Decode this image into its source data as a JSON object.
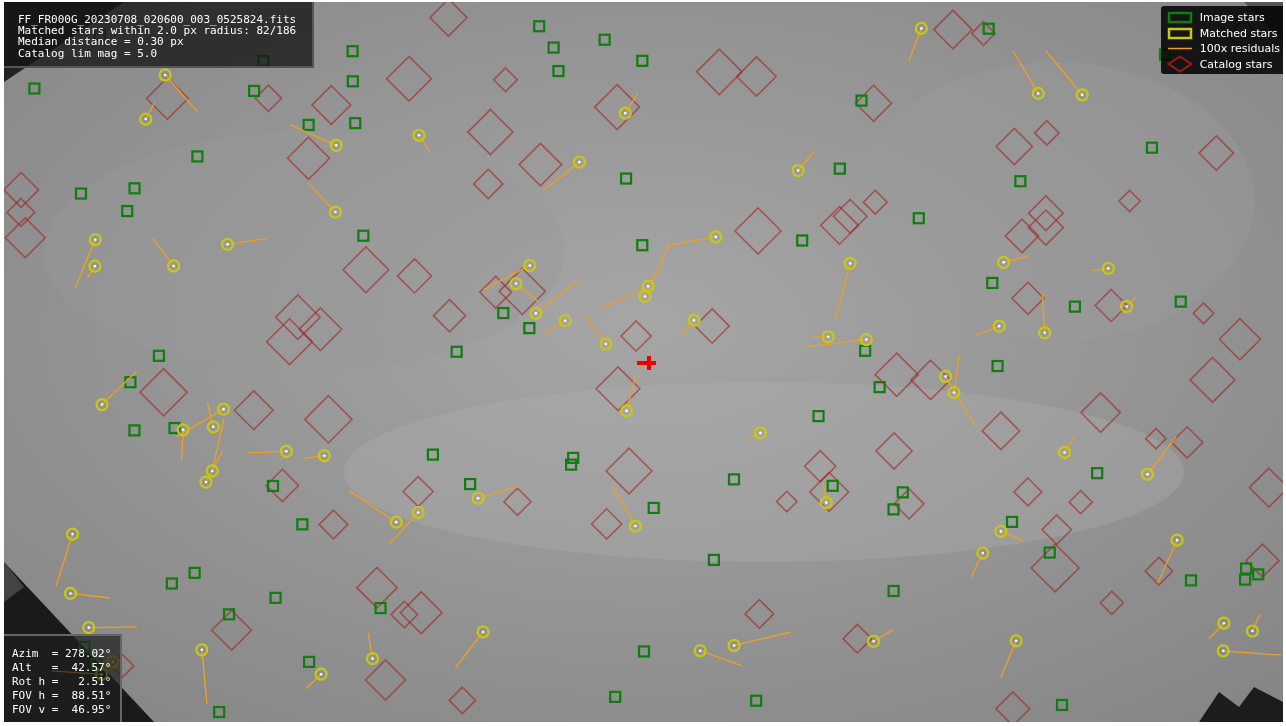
{
  "info_panel": {
    "lines": [
      "FF_FR000G_20230708_020600_003_0525824.fits",
      "Matched stars within 2.0 px radius: 82/186",
      "Median distance = 0.30 px",
      "Catalog lim mag = 5.0"
    ]
  },
  "legend": {
    "items": [
      {
        "label": "Image stars",
        "kind": "box",
        "color": "#0f7d0f"
      },
      {
        "label": "Matched stars",
        "kind": "box",
        "color": "#c8c814"
      },
      {
        "label": "100x residuals",
        "kind": "line",
        "color": "#f0a020"
      },
      {
        "label": "Catalog stars",
        "kind": "diamond",
        "color": "#a01818"
      }
    ]
  },
  "pointing_panel": {
    "lines": [
      "Azim  = 278.02°",
      "Alt   =  42.57°",
      "Rot h =   2.51°",
      "FOV h =  88.51°",
      "FOV v =  46.95°"
    ]
  }
}
